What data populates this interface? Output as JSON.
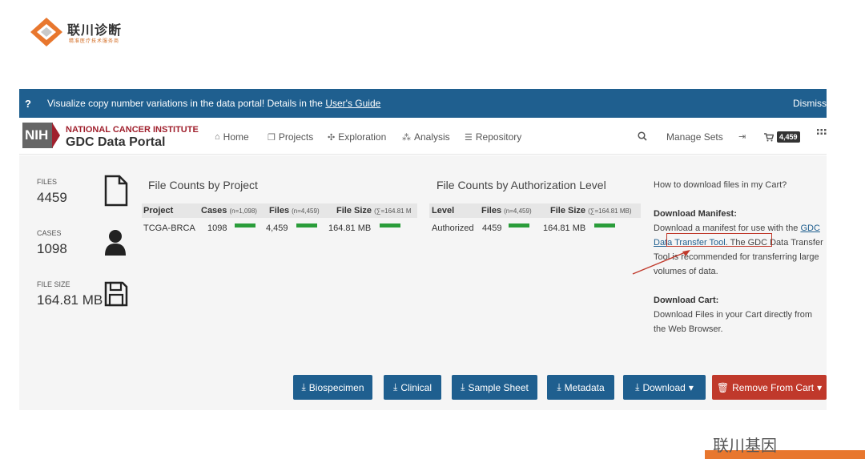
{
  "logo": {
    "name": "联川诊断",
    "tagline": "精准医疗技术服务商"
  },
  "banner": {
    "help_icon": "?",
    "message": "Visualize copy number variations in the data portal! Details in the ",
    "link": "User's Guide",
    "dismiss": "Dismiss"
  },
  "nav": {
    "nih": "NIH",
    "institute": "NATIONAL CANCER INSTITUTE",
    "portal": "GDC Data Portal",
    "items": [
      {
        "icon": "home-icon",
        "label": "Home"
      },
      {
        "icon": "projects-icon",
        "label": "Projects"
      },
      {
        "icon": "exploration-icon",
        "label": "Exploration"
      },
      {
        "icon": "analysis-icon",
        "label": "Analysis"
      },
      {
        "icon": "repository-icon",
        "label": "Repository"
      }
    ],
    "manage_sets": "Manage Sets",
    "cart_count": "4,459"
  },
  "summary": [
    {
      "label": "FILES",
      "value": "4459",
      "icon": "file-icon"
    },
    {
      "label": "CASES",
      "value": "1098",
      "icon": "user-icon"
    },
    {
      "label": "FILE SIZE",
      "value": "164.81 MB",
      "icon": "save-icon"
    }
  ],
  "project_table": {
    "title": "File Counts by Project",
    "headers": {
      "project": "Project",
      "cases": "Cases",
      "cases_note": "(n=1,098)",
      "files": "Files",
      "files_note": "(n=4,459)",
      "size": "File Size",
      "size_note": "(∑=164.81 M"
    },
    "row": {
      "project": "TCGA-BRCA",
      "cases": "1098",
      "files": "4,459",
      "size": "164.81 MB"
    }
  },
  "auth_table": {
    "title": "File Counts by Authorization Level",
    "headers": {
      "level": "Level",
      "files": "Files",
      "files_note": "(n=4,459)",
      "size": "File Size",
      "size_note": "(∑=164.81 MB)"
    },
    "row": {
      "level": "Authorized",
      "files": "4459",
      "size": "164.81 MB"
    }
  },
  "help": {
    "question": "How to download files in my Cart?",
    "manifest_title": "Download Manifest:",
    "manifest_text_1": "Download a manifest for use with the ",
    "manifest_link": "GDC Data Transfer Tool",
    "manifest_text_2": ". The GDC Data Transfer Tool is recommended for transferring large volumes of data.",
    "cart_title": "Download Cart:",
    "cart_text": "Download Files in your Cart directly from the Web Browser."
  },
  "buttons": {
    "biospecimen": "Biospecimen",
    "clinical": "Clinical",
    "sample_sheet": "Sample Sheet",
    "metadata": "Metadata",
    "download": "Download",
    "remove": "Remove From Cart"
  },
  "watermark": "联川基因",
  "colors": {
    "banner": "#1f5f8f",
    "nci_red": "#a0202d",
    "bar_green": "#2a9d3a",
    "remove_red": "#c0392b"
  }
}
